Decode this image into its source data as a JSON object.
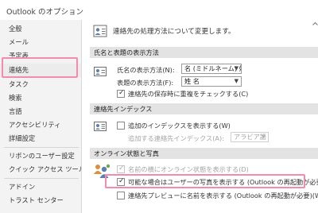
{
  "window": {
    "title": "Outlook のオプション"
  },
  "sidebar": {
    "items": [
      {
        "label": "全般"
      },
      {
        "label": "メール"
      },
      {
        "label": "予定表"
      },
      {
        "label": "連絡先"
      },
      {
        "label": "タスク"
      },
      {
        "label": "検索"
      },
      {
        "label": "言語"
      },
      {
        "label": "アクセシビリティ"
      },
      {
        "label": "詳細設定"
      },
      {
        "label": "リボンのユーザー設定"
      },
      {
        "label": "クイック アクセス ツール バー"
      },
      {
        "label": "アドイン"
      },
      {
        "label": "トラスト センター"
      }
    ],
    "selected": "連絡先"
  },
  "header": {
    "text": "連絡先の処理方法について変更します。",
    "icon": "contact-card-icon"
  },
  "names_section": {
    "title": "氏名と表題の表示方法",
    "display_name_label": "氏名の表示方法(N):",
    "display_name_value": "名 (ミドルネーム) 姓",
    "file_as_label": "表題の表示方法(F):",
    "file_as_value": "姓 名",
    "duplicate_check_label": "連絡先の保存時に重複をチェックする(C)",
    "duplicate_check_checked": true
  },
  "index_section": {
    "title": "連絡先インデックス",
    "additional_index_label": "追加のインデックスを表示する(W)",
    "additional_index_checked": false,
    "index_language_label": "追加する連絡先インデックス(A):",
    "index_language_value": "アラビア語"
  },
  "online_section": {
    "title": "オンライン状態と写真",
    "online_status_label": "名前の横にオンライン状態を表示する(D)",
    "online_status_checked": true,
    "show_photo_label": "可能な場合はユーザーの写真を表示する (Outlook の再起動が必要)(P)",
    "show_photo_checked": true,
    "preview_label": "連絡先プレビューに名前を表示する (Outlook の再起動が必要)(W)",
    "preview_checked": false
  },
  "colors": {
    "highlight": "#f28bb0",
    "section_bg": "#e3e3e3",
    "sidebar_bg": "#f3f3f3"
  }
}
